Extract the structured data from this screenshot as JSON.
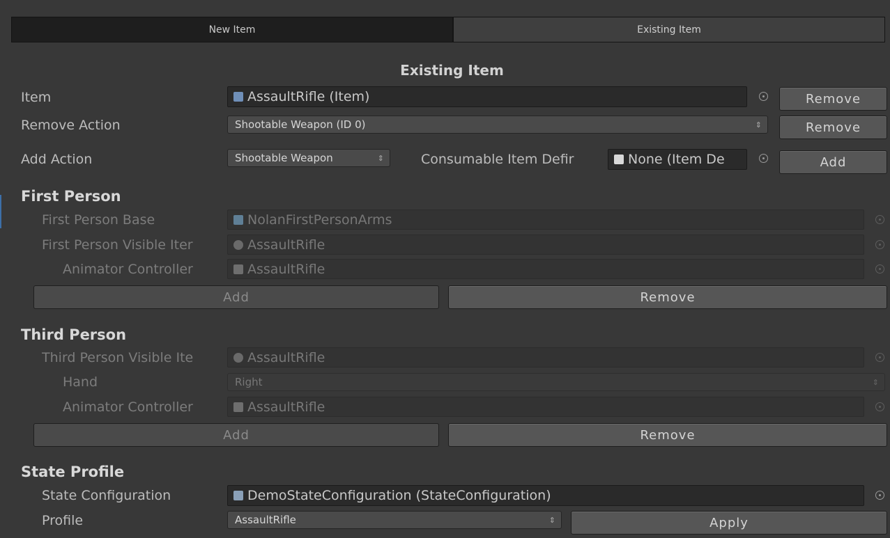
{
  "tabs": {
    "new_item": "New Item",
    "existing_item": "Existing Item"
  },
  "header": {
    "title": "Existing Item"
  },
  "item_row": {
    "label": "Item",
    "value": "AssaultRifle (Item)",
    "button": "Remove"
  },
  "remove_action_row": {
    "label": "Remove Action",
    "selected": "Shootable Weapon (ID 0)",
    "button": "Remove"
  },
  "add_action_row": {
    "label": "Add Action",
    "selected": "Shootable Weapon",
    "consumable_label": "Consumable Item Defir",
    "consumable_value": "None (Item De",
    "button": "Add"
  },
  "first_person": {
    "title": "First Person",
    "base_label": "First Person Base",
    "base_value": "NolanFirstPersonArms",
    "visible_label": "First Person Visible Iter",
    "visible_value": "AssaultRifle",
    "animator_label": "Animator Controller",
    "animator_value": "AssaultRifle",
    "add_button": "Add",
    "remove_button": "Remove"
  },
  "third_person": {
    "title": "Third Person",
    "visible_label": "Third Person Visible Ite",
    "visible_value": "AssaultRifle",
    "hand_label": "Hand",
    "hand_value": "Right",
    "animator_label": "Animator Controller",
    "animator_value": "AssaultRifle",
    "add_button": "Add",
    "remove_button": "Remove"
  },
  "state_profile": {
    "title": "State Profile",
    "config_label": "State Configuration",
    "config_value": "DemoStateConfiguration (StateConfiguration)",
    "profile_label": "Profile",
    "profile_value": "AssaultRifle",
    "apply_button": "Apply"
  },
  "glyphs": {
    "dropdown_arrow": "⇕"
  },
  "colors": {
    "background": "#383838",
    "selection_mark": "#3d6fa8"
  }
}
